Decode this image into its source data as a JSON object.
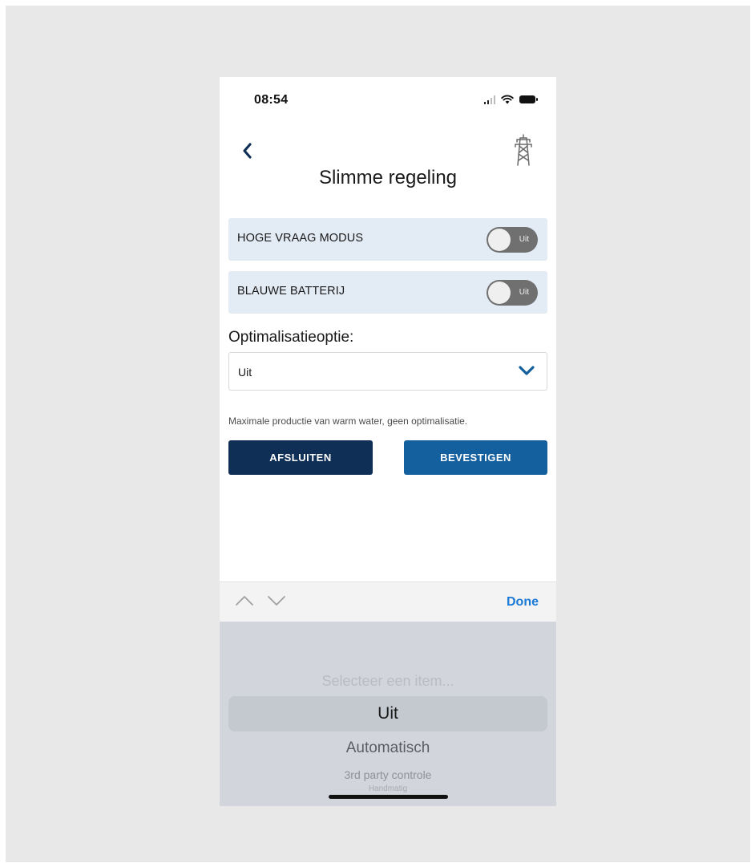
{
  "status_bar": {
    "time": "08:54",
    "icons": [
      "signal-icon",
      "wifi-icon",
      "battery-icon"
    ]
  },
  "header": {
    "back_icon": "chevron-left-icon",
    "title": "Slimme regeling",
    "right_icon": "power-pylon-icon"
  },
  "toggles": [
    {
      "label": "HOGE VRAAG MODUS",
      "state_label": "Uit",
      "on": false
    },
    {
      "label": "BLAUWE BATTERIJ",
      "state_label": "Uit",
      "on": false
    }
  ],
  "optimization": {
    "label": "Optimalisatieoptie:",
    "selected_value": "Uit",
    "dropdown_icon": "chevron-down-icon",
    "description": "Maximale productie van warm water, geen optimalisatie."
  },
  "actions": {
    "close_label": "AFSLUITEN",
    "confirm_label": "BEVESTIGEN"
  },
  "keyboard_accessory": {
    "prev_icon": "chevron-up-icon",
    "next_icon": "chevron-down-icon",
    "done_label": "Done"
  },
  "picker": {
    "options": [
      "Selecteer een item...",
      "Uit",
      "Automatisch",
      "3rd party controle",
      "Handmatig"
    ],
    "selected_index": 1
  },
  "colors": {
    "accent": "#1a7ad6",
    "primary_dark": "#0f2f57",
    "primary": "#145f9e",
    "row_background": "#e3ebf5",
    "toggle_off": "#707070",
    "picker_background": "#d2d5db"
  }
}
